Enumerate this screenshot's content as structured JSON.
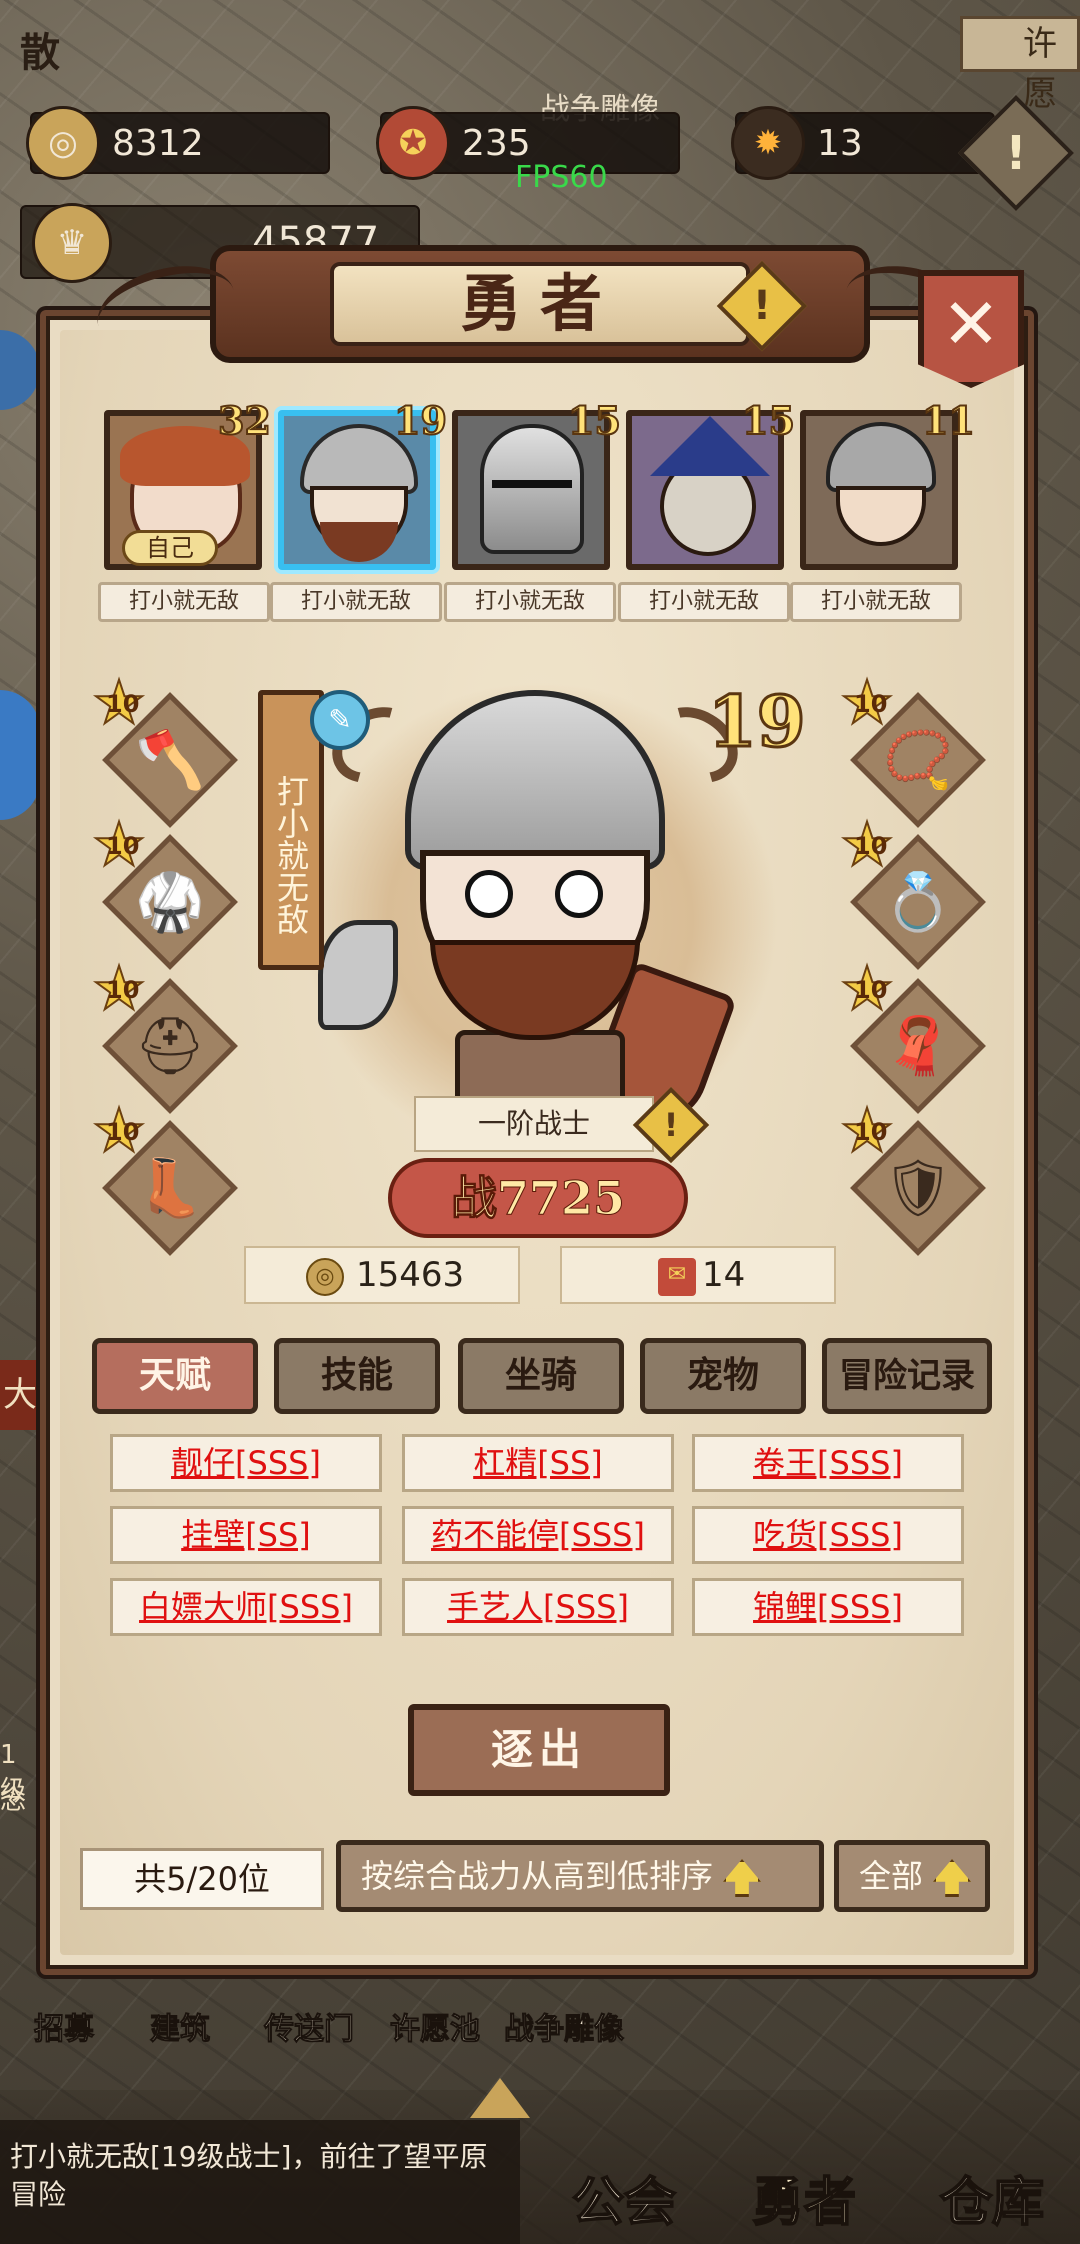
{
  "top": {
    "gold": "8312",
    "emblem": "235",
    "gem": "13",
    "power": "45877",
    "fps": "FPS60",
    "top_label_left": "散",
    "top_label_mid": "战争雕像",
    "top_label_right": "许愿"
  },
  "panel": {
    "title": "勇者",
    "info_glyph": "!",
    "close_glyph": "✕"
  },
  "heroes": [
    {
      "level": "32",
      "name": "打小就无敌",
      "self_tag": "自己"
    },
    {
      "level": "19",
      "name": "打小就无敌"
    },
    {
      "level": "15",
      "name": "打小就无敌"
    },
    {
      "level": "15",
      "name": "打小就无敌"
    },
    {
      "level": "11",
      "name": "打小就无敌"
    }
  ],
  "equipment": {
    "left": [
      {
        "level": "10",
        "icon": "axe-icon",
        "glyph": "🪓"
      },
      {
        "level": "10",
        "icon": "armor-icon",
        "glyph": "🥋"
      },
      {
        "level": "10",
        "icon": "helmet-icon",
        "glyph": "⛑"
      },
      {
        "level": "10",
        "icon": "boots-icon",
        "glyph": "👢"
      }
    ],
    "right": [
      {
        "level": "10",
        "icon": "necklace-icon",
        "glyph": "📿"
      },
      {
        "level": "10",
        "icon": "ring-icon",
        "glyph": "💍"
      },
      {
        "level": "10",
        "icon": "cape-icon",
        "glyph": "🧣"
      },
      {
        "level": "10",
        "icon": "shield-icon",
        "glyph": "🛡"
      }
    ]
  },
  "hero_detail": {
    "level": "19",
    "title_flag": "打小就无敌",
    "rank": "一阶战士",
    "power_prefix": "战",
    "power": "7725",
    "gold": "15463",
    "scroll": "14"
  },
  "tabs": [
    "天赋",
    "技能",
    "坐骑",
    "宠物",
    "冒险记录"
  ],
  "talents": [
    "靓仔[SSS]",
    "杠精[SS]",
    "卷王[SSS]",
    "挂壁[SS]",
    "药不能停[SSS]",
    "吃货[SSS]",
    "白嫖大师[SSS]",
    "手艺人[SSS]",
    "锦鲤[SSS]"
  ],
  "actions": {
    "expel": "逐出",
    "count": "共5/20位",
    "sort": "按综合战力从高到低排序",
    "filter": "全部"
  },
  "bottom_menu": [
    "招募",
    "建筑",
    "传送门",
    "许愿池",
    "战争雕像"
  ],
  "message": "打小就无敌[19级战士]，前往了望平原冒险",
  "nav": [
    "公会",
    "勇者",
    "仓库"
  ],
  "side": {
    "left_a": "大",
    "left_b": "1级",
    "left_c": "念"
  },
  "colors": {
    "talent_text": "#e01010",
    "selected_border": "#38bff0",
    "active_tab": "#b56e5e"
  }
}
